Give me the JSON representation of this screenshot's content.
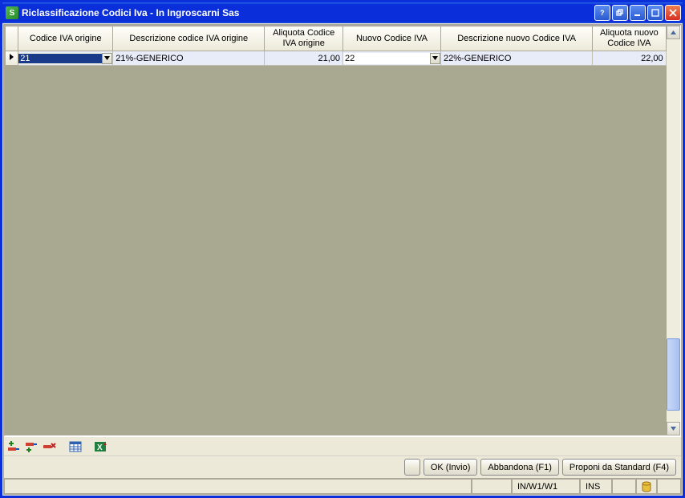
{
  "window": {
    "title": "Riclassificazione Codici Iva - In Ingroscarni Sas"
  },
  "grid": {
    "headers": {
      "c1": "Codice IVA origine",
      "c2": "Descrizione codice IVA origine",
      "c3": "Aliquota Codice IVA origine",
      "c4": "Nuovo Codice IVA",
      "c5": "Descrizione nuovo Codice IVA",
      "c6": "Aliquota nuovo Codice IVA"
    },
    "row": {
      "codOrig": "21",
      "descOrig": "21%-GENERICO",
      "aliqOrig": "21,00",
      "codNew": "22",
      "descNew": "22%-GENERICO",
      "aliqNew": "22,00"
    }
  },
  "buttons": {
    "ok": "OK (Invio)",
    "abbandona": "Abbandona (F1)",
    "proponi": "Proponi da Standard (F4)"
  },
  "status": {
    "path": "IN/W1/W1",
    "mode": "INS"
  },
  "icons": {
    "rowInsertBefore": "row-insert-before-icon",
    "rowInsertAfter": "row-insert-after-icon",
    "rowDelete": "row-delete-icon",
    "table": "table-icon",
    "excel": "excel-icon"
  }
}
